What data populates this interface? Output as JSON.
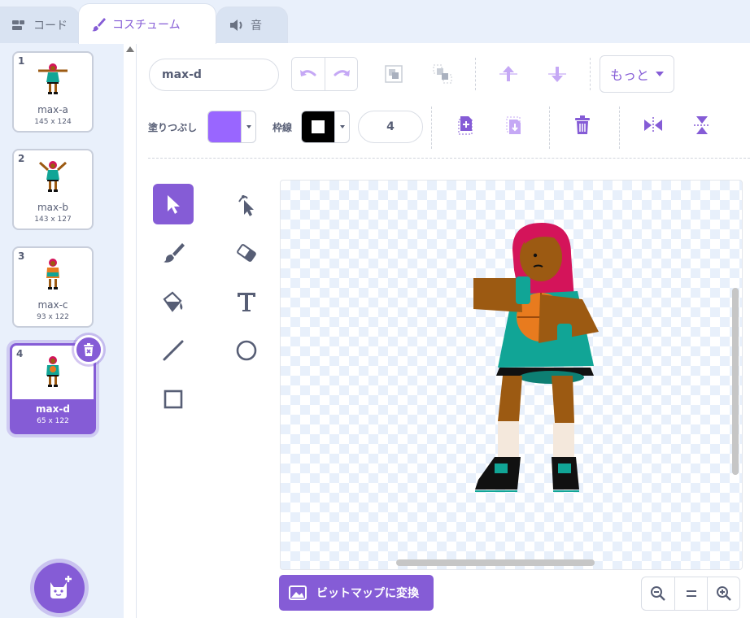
{
  "tabs": [
    {
      "label": "コード",
      "icon": "code-icon",
      "active": false
    },
    {
      "label": "コスチューム",
      "icon": "paintbrush-icon",
      "active": true
    },
    {
      "label": "音",
      "icon": "speaker-icon",
      "active": false
    }
  ],
  "costumes": [
    {
      "number": "1",
      "name": "max-a",
      "size": "145 x 124"
    },
    {
      "number": "2",
      "name": "max-b",
      "size": "143 x 127"
    },
    {
      "number": "3",
      "name": "max-c",
      "size": "93 x 122"
    },
    {
      "number": "4",
      "name": "max-d",
      "size": "65 x 122",
      "selected": true
    }
  ],
  "editor": {
    "costume_name": "max-d",
    "more_label": "もっと",
    "fill_label": "塗りつぶし",
    "fill_color": "#9966ff",
    "outline_label": "枠線",
    "outline_color": "#000000",
    "outline_width": "4",
    "convert_label": "ビットマップに変換"
  },
  "colors": {
    "accent": "#855cd6",
    "icon_light": "#c5a8f5"
  }
}
